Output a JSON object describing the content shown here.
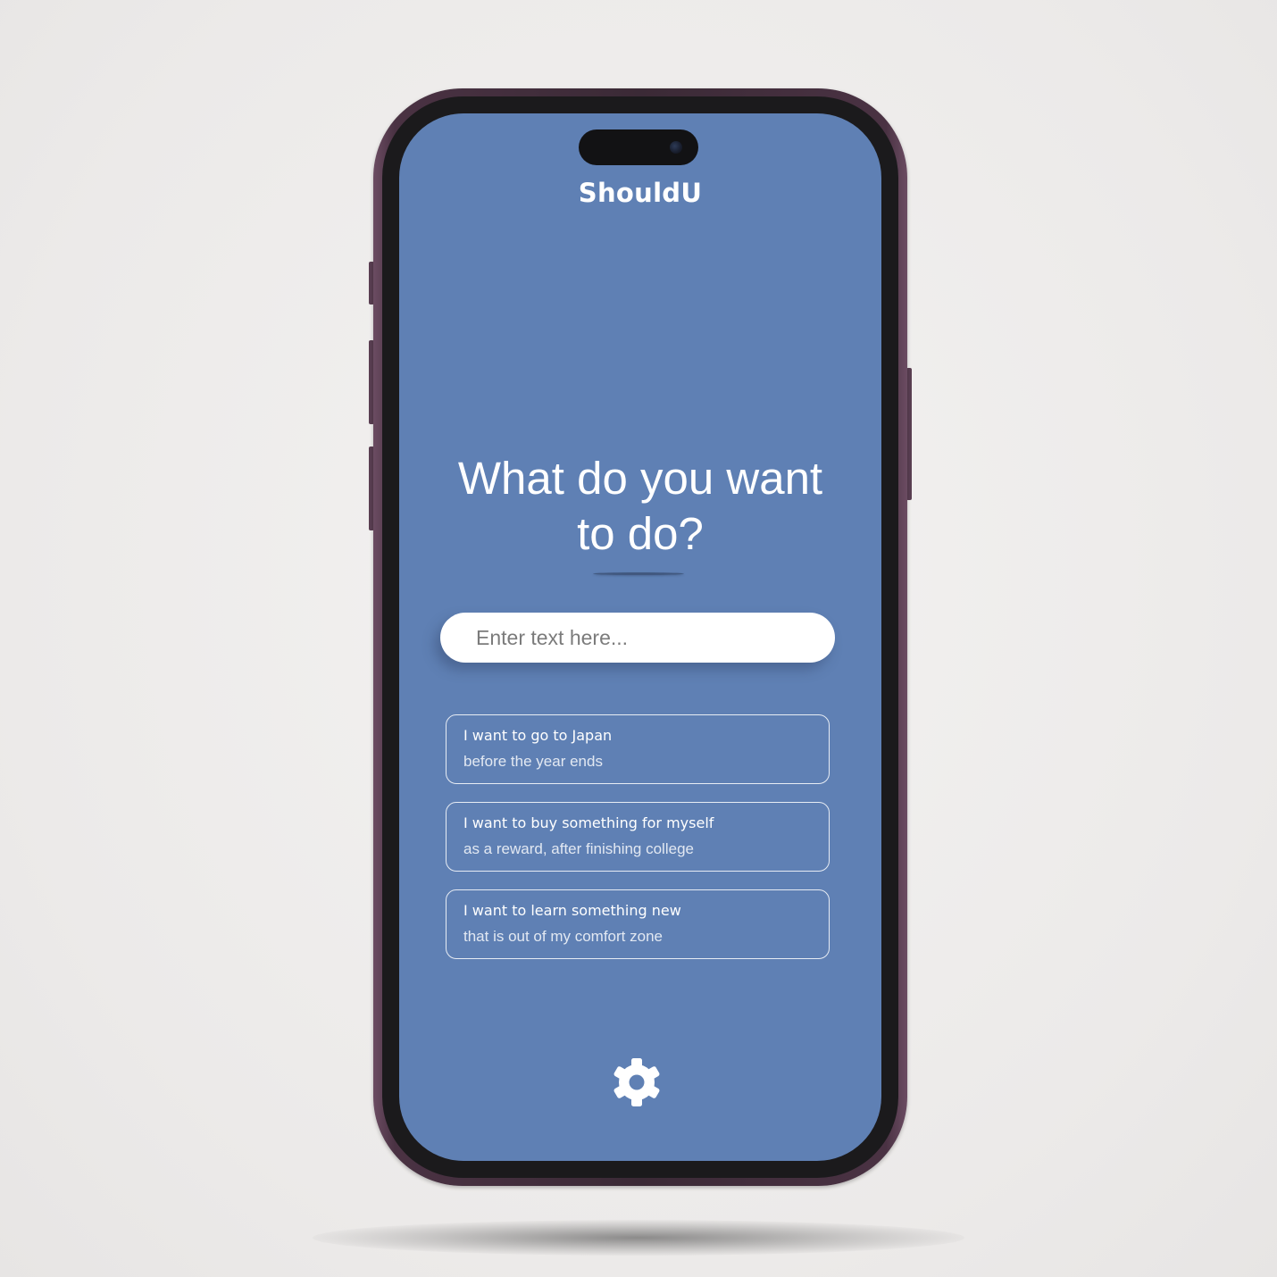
{
  "app": {
    "title": "ShouldU"
  },
  "main": {
    "headline_line1": "What do you want",
    "headline_line2": "to do?"
  },
  "search": {
    "placeholder": "Enter text here...",
    "value": ""
  },
  "suggestions": [
    {
      "main": "I want to go to Japan",
      "sub": "before the year ends"
    },
    {
      "main": "I want to buy something for myself",
      "sub": "as a reward, after finishing college"
    },
    {
      "main": "I want to learn something new",
      "sub": "that is out of my comfort zone"
    }
  ],
  "footer": {
    "icon": "gear-icon"
  },
  "colors": {
    "screen_background": "#5f80b4",
    "text": "#ffffff",
    "input_background": "#ffffff",
    "phone_frame": "#3b2a36"
  }
}
